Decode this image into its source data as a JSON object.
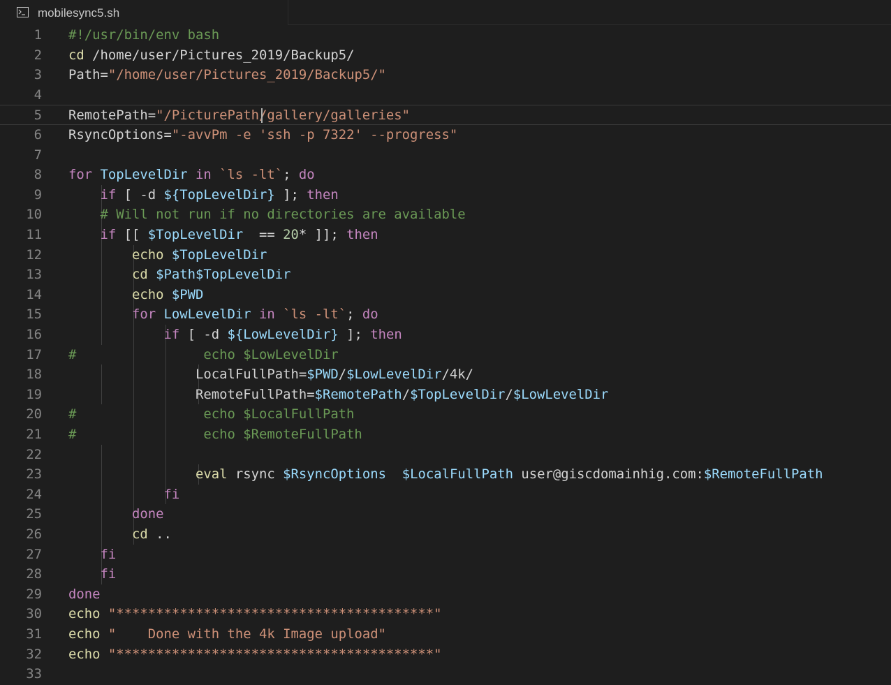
{
  "tab": {
    "filename": "mobilesync5.sh",
    "icon": "terminal-file-icon"
  },
  "colors": {
    "background": "#1e1e1e",
    "line_number": "#858585",
    "comment": "#6a9955",
    "keyword": "#c586c0",
    "builtin": "#dcdcaa",
    "variable": "#9cdcfe",
    "string": "#ce9178",
    "number": "#b5cea8",
    "plain": "#d4d4d4"
  },
  "editor": {
    "current_line": 5,
    "lines": [
      {
        "n": "1",
        "tokens": [
          [
            "comment",
            "#!/usr/bin/env bash"
          ]
        ]
      },
      {
        "n": "2",
        "tokens": [
          [
            "builtin",
            "cd"
          ],
          [
            "plain",
            " /home/user/Pictures_2019/Backup5/"
          ]
        ]
      },
      {
        "n": "3",
        "tokens": [
          [
            "plain",
            "Path="
          ],
          [
            "string",
            "\"/home/user/Pictures_2019/Backup5/\""
          ]
        ]
      },
      {
        "n": "4",
        "tokens": []
      },
      {
        "n": "5",
        "tokens": [
          [
            "plain",
            "RemotePath="
          ],
          [
            "string",
            "\"/PicturePath/gallery/galleries\""
          ]
        ]
      },
      {
        "n": "6",
        "tokens": [
          [
            "plain",
            "RsyncOptions="
          ],
          [
            "string",
            "\"-avvPm -e 'ssh -p 7322' --progress\""
          ]
        ]
      },
      {
        "n": "7",
        "tokens": []
      },
      {
        "n": "8",
        "tokens": [
          [
            "keyword",
            "for"
          ],
          [
            "plain",
            " "
          ],
          [
            "variable",
            "TopLevelDir"
          ],
          [
            "plain",
            " "
          ],
          [
            "keyword",
            "in"
          ],
          [
            "plain",
            " "
          ],
          [
            "string",
            "`ls -lt`"
          ],
          [
            "plain",
            "; "
          ],
          [
            "keyword",
            "do"
          ]
        ]
      },
      {
        "n": "9",
        "tokens": [
          [
            "plain",
            "    "
          ],
          [
            "keyword",
            "if"
          ],
          [
            "plain",
            " [ -d "
          ],
          [
            "variable",
            "${TopLevelDir}"
          ],
          [
            "plain",
            " ]; "
          ],
          [
            "keyword",
            "then"
          ]
        ]
      },
      {
        "n": "10",
        "tokens": [
          [
            "plain",
            "    "
          ],
          [
            "comment",
            "# Will not run if no directories are available"
          ]
        ]
      },
      {
        "n": "11",
        "tokens": [
          [
            "plain",
            "    "
          ],
          [
            "keyword",
            "if"
          ],
          [
            "plain",
            " [[ "
          ],
          [
            "variable",
            "$TopLevelDir"
          ],
          [
            "plain",
            "  == "
          ],
          [
            "number",
            "20"
          ],
          [
            "plain",
            "* ]]; "
          ],
          [
            "keyword",
            "then"
          ]
        ]
      },
      {
        "n": "12",
        "tokens": [
          [
            "plain",
            "        "
          ],
          [
            "builtin",
            "echo"
          ],
          [
            "plain",
            " "
          ],
          [
            "variable",
            "$TopLevelDir"
          ]
        ]
      },
      {
        "n": "13",
        "tokens": [
          [
            "plain",
            "        "
          ],
          [
            "builtin",
            "cd"
          ],
          [
            "plain",
            " "
          ],
          [
            "variable",
            "$Path$TopLevelDir"
          ]
        ]
      },
      {
        "n": "14",
        "tokens": [
          [
            "plain",
            "        "
          ],
          [
            "builtin",
            "echo"
          ],
          [
            "plain",
            " "
          ],
          [
            "variable",
            "$PWD"
          ]
        ]
      },
      {
        "n": "15",
        "tokens": [
          [
            "plain",
            "        "
          ],
          [
            "keyword",
            "for"
          ],
          [
            "plain",
            " "
          ],
          [
            "variable",
            "LowLevelDir"
          ],
          [
            "plain",
            " "
          ],
          [
            "keyword",
            "in"
          ],
          [
            "plain",
            " "
          ],
          [
            "string",
            "`ls -lt`"
          ],
          [
            "plain",
            "; "
          ],
          [
            "keyword",
            "do"
          ]
        ]
      },
      {
        "n": "16",
        "tokens": [
          [
            "plain",
            "            "
          ],
          [
            "keyword",
            "if"
          ],
          [
            "plain",
            " [ -d "
          ],
          [
            "variable",
            "${LowLevelDir}"
          ],
          [
            "plain",
            " ]; "
          ],
          [
            "keyword",
            "then"
          ]
        ]
      },
      {
        "n": "17",
        "tokens": [
          [
            "comment",
            "#                echo $LowLevelDir"
          ]
        ]
      },
      {
        "n": "18",
        "tokens": [
          [
            "plain",
            "                LocalFullPath="
          ],
          [
            "variable",
            "$PWD"
          ],
          [
            "plain",
            "/"
          ],
          [
            "variable",
            "$LowLevelDir"
          ],
          [
            "plain",
            "/4k/"
          ]
        ]
      },
      {
        "n": "19",
        "tokens": [
          [
            "plain",
            "                RemoteFullPath="
          ],
          [
            "variable",
            "$RemotePath"
          ],
          [
            "plain",
            "/"
          ],
          [
            "variable",
            "$TopLevelDir"
          ],
          [
            "plain",
            "/"
          ],
          [
            "variable",
            "$LowLevelDir"
          ]
        ]
      },
      {
        "n": "20",
        "tokens": [
          [
            "comment",
            "#                echo $LocalFullPath"
          ]
        ]
      },
      {
        "n": "21",
        "tokens": [
          [
            "comment",
            "#                echo $RemoteFullPath"
          ]
        ]
      },
      {
        "n": "22",
        "tokens": []
      },
      {
        "n": "23",
        "tokens": [
          [
            "plain",
            "                "
          ],
          [
            "builtin",
            "eval"
          ],
          [
            "plain",
            " rsync "
          ],
          [
            "variable",
            "$RsyncOptions"
          ],
          [
            "plain",
            "  "
          ],
          [
            "variable",
            "$LocalFullPath"
          ],
          [
            "plain",
            " user@giscdomainhig.com:"
          ],
          [
            "variable",
            "$RemoteFullPath"
          ]
        ]
      },
      {
        "n": "24",
        "tokens": [
          [
            "plain",
            "            "
          ],
          [
            "keyword",
            "fi"
          ]
        ]
      },
      {
        "n": "25",
        "tokens": [
          [
            "plain",
            "        "
          ],
          [
            "keyword",
            "done"
          ]
        ]
      },
      {
        "n": "26",
        "tokens": [
          [
            "plain",
            "        "
          ],
          [
            "builtin",
            "cd"
          ],
          [
            "plain",
            " .."
          ]
        ]
      },
      {
        "n": "27",
        "tokens": [
          [
            "plain",
            "    "
          ],
          [
            "keyword",
            "fi"
          ]
        ]
      },
      {
        "n": "28",
        "tokens": [
          [
            "plain",
            "    "
          ],
          [
            "keyword",
            "fi"
          ]
        ]
      },
      {
        "n": "29",
        "tokens": [
          [
            "keyword",
            "done"
          ]
        ]
      },
      {
        "n": "30",
        "tokens": [
          [
            "builtin",
            "echo"
          ],
          [
            "plain",
            " "
          ],
          [
            "string",
            "\"****************************************\""
          ]
        ]
      },
      {
        "n": "31",
        "tokens": [
          [
            "builtin",
            "echo"
          ],
          [
            "plain",
            " "
          ],
          [
            "string",
            "\"    Done with the 4k Image upload\""
          ]
        ]
      },
      {
        "n": "32",
        "tokens": [
          [
            "builtin",
            "echo"
          ],
          [
            "plain",
            " "
          ],
          [
            "string",
            "\"****************************************\""
          ]
        ]
      },
      {
        "n": "33",
        "tokens": []
      }
    ]
  }
}
